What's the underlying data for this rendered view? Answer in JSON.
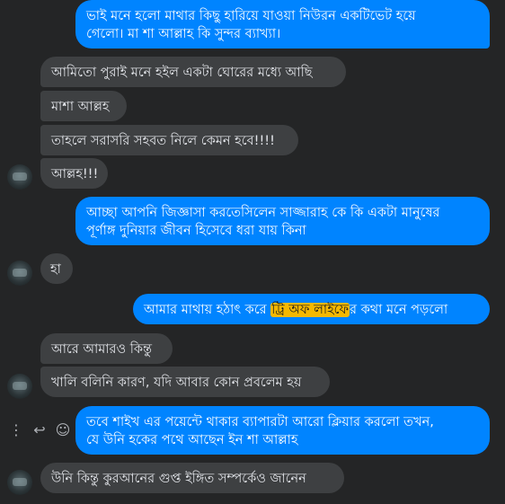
{
  "messages": [
    {
      "id": "m1",
      "dir": "out",
      "text_line1": "ভাই মনে হলো মাথার কিছু হারিয়ে যাওয়া নিউরন একটিভেট হয়ে",
      "text_line2": "গেলো। মা শা আল্লাহ কি সুন্দর ব্যাখ্যা।"
    },
    {
      "id": "m2",
      "dir": "in",
      "text": "আমিতো পুরাই মনে হইল একটা ঘোরের মধ্যে আছি"
    },
    {
      "id": "m3",
      "dir": "in",
      "text": "মাশা আল্লহ"
    },
    {
      "id": "m4",
      "dir": "in",
      "text": "তাহলে সরাসরি সহবত নিলে কেমন হবে!!!!"
    },
    {
      "id": "m5",
      "dir": "in",
      "text": "আল্লহ!!!"
    },
    {
      "id": "m6",
      "dir": "out",
      "text_line1": "আচ্ছা আপনি জিজ্ঞাসা করতেসিলেন সাজ্জারাহ কে কি একটা মানুষের",
      "text_line2": "পূর্ণাঙ্গ দুনিয়ার জীবন হিসেবে ধরা যায় কিনা"
    },
    {
      "id": "m7",
      "dir": "in",
      "text": "হা"
    },
    {
      "id": "m8",
      "dir": "out",
      "text_before": "আমার মাথায় হঠাৎ করে ",
      "text_highlight": "ট্রি অফ লাইফে",
      "text_after": "র কথা মনে পড়লো"
    },
    {
      "id": "m9",
      "dir": "in",
      "text": "আরে আমারও কিন্তু"
    },
    {
      "id": "m10",
      "dir": "in",
      "text": "খালি বলিনি কারণ, যদি আবার কোন প্রবলেম হয়"
    },
    {
      "id": "m11",
      "dir": "out",
      "text_line1": "তবে শাইখ এর পয়েন্টে থাকার ব্যাপারটা আরো ক্লিয়ার করলো তখন,",
      "text_line2": "যে উনি হকের পথে আছেন ইন শা আল্লাহ"
    },
    {
      "id": "m12",
      "dir": "in",
      "text": "উনি কিন্তু কুরআনের গুপ্ত ইঙ্গিত সম্পর্কেও জানেন"
    }
  ],
  "message_actions": {
    "more": "⋮",
    "reply": "↩",
    "react": "☺"
  },
  "colors": {
    "background": "#242526",
    "incoming": "#3e4042",
    "outgoing": "#0084ff",
    "highlight": "#f5b800"
  }
}
